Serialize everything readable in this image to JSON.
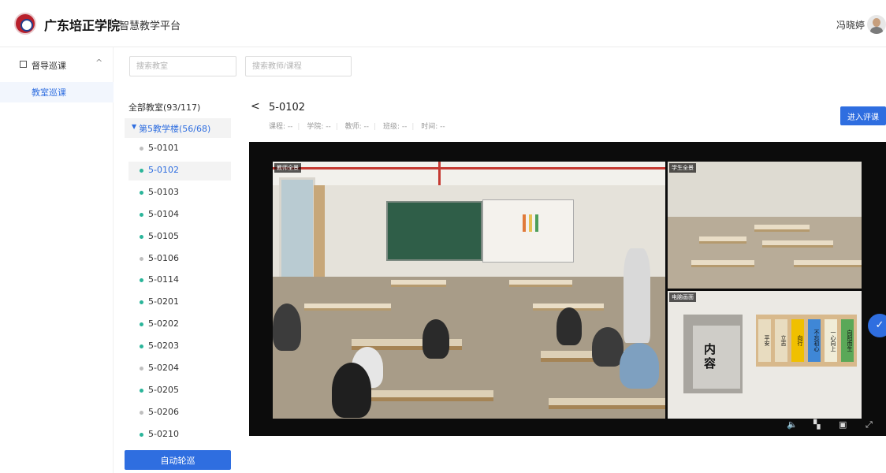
{
  "header": {
    "school_name": "广东培正学院",
    "platform_name": "智慧教学平台",
    "user_name": "冯晓婷"
  },
  "sidebar": {
    "group_label": "督导巡课",
    "group_caret": "^",
    "items": [
      {
        "label": "教室巡课",
        "active": true
      }
    ]
  },
  "search": {
    "classroom_placeholder": "搜索教室",
    "teacher_placeholder": "搜索教师/课程"
  },
  "tree": {
    "all_label": "全部教室(93/117)",
    "building_label": "第5教学楼(56/68)",
    "rooms": [
      {
        "name": "5-0101",
        "online": false,
        "selected": false
      },
      {
        "name": "5-0102",
        "online": true,
        "selected": true
      },
      {
        "name": "5-0103",
        "online": true,
        "selected": false
      },
      {
        "name": "5-0104",
        "online": true,
        "selected": false
      },
      {
        "name": "5-0105",
        "online": true,
        "selected": false
      },
      {
        "name": "5-0106",
        "online": false,
        "selected": false
      },
      {
        "name": "5-0114",
        "online": true,
        "selected": false
      },
      {
        "name": "5-0201",
        "online": true,
        "selected": false
      },
      {
        "name": "5-0202",
        "online": true,
        "selected": false
      },
      {
        "name": "5-0203",
        "online": true,
        "selected": false
      },
      {
        "name": "5-0204",
        "online": false,
        "selected": false
      },
      {
        "name": "5-0205",
        "online": true,
        "selected": false
      },
      {
        "name": "5-0206",
        "online": false,
        "selected": false
      },
      {
        "name": "5-0210",
        "online": true,
        "selected": false
      }
    ],
    "auto_patrol_label": "自动轮巡"
  },
  "detail": {
    "back_symbol": "<",
    "room_title": "5-0102",
    "meta": [
      "课程: --",
      "学院: --",
      "教师: --",
      "班级: --",
      "时间: --"
    ],
    "enter_button_label": "进入评课"
  },
  "video": {
    "teacher_view_label": "教师全景",
    "student_view_label": "学生全景",
    "pc_view_label": "电脑画面",
    "pc_slide_title": "内容",
    "pc_cards": [
      "平安",
      "立志",
      "向行",
      "不忘初心",
      "一心向上",
      "向阳而生"
    ],
    "controls": {
      "volume_icon": "volume-icon",
      "layout_icon": "layout-icon",
      "screenshot_icon": "screenshot-icon",
      "fullscreen_icon": "fullscreen-icon"
    }
  },
  "colors": {
    "primary": "#2f6ee0",
    "online_dot": "#2bb59a",
    "offline_dot": "#bfbfbf"
  }
}
